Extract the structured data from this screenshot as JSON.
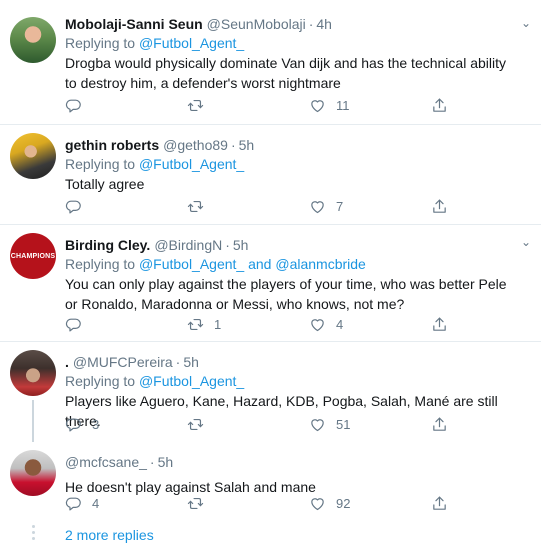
{
  "tweets": [
    {
      "name": "Mobolaji-Sanni Seun",
      "handle": "@SeunMobolaji",
      "time": "4h",
      "replying_prefix": "Replying to",
      "replying_to": "@Futbol_Agent_",
      "replying_and": "",
      "replying_to_2": "",
      "text": "Drogba would physically dominate Van dijk and has the technical ability to destroy him, a defender's worst nightmare",
      "replies": "",
      "retweets": "",
      "likes": "11"
    },
    {
      "name": "gethin roberts",
      "handle": "@getho89",
      "time": "5h",
      "replying_prefix": "Replying to",
      "replying_to": "@Futbol_Agent_",
      "replying_and": "",
      "replying_to_2": "",
      "text": "Totally agree",
      "replies": "",
      "retweets": "",
      "likes": "7"
    },
    {
      "name": "Birding Cley.",
      "handle": "@BirdingN",
      "time": "5h",
      "replying_prefix": "Replying to",
      "replying_to": "@Futbol_Agent_",
      "replying_and": "and",
      "replying_to_2": "@alanmcbride",
      "text": "You can only play against the players of your time, who was better Pele or Ronaldo, Maradonna or Messi, who knows, not me?",
      "replies": "",
      "retweets": "1",
      "likes": "4"
    },
    {
      "name": ".",
      "handle": "@MUFCPereira",
      "time": "5h",
      "replying_prefix": "Replying to",
      "replying_to": "@Futbol_Agent_",
      "replying_and": "",
      "replying_to_2": "",
      "text": "Players like Aguero, Kane, Hazard, KDB, Pogba, Salah, Mané are still there.",
      "replies": "3",
      "retweets": "",
      "likes": "51"
    },
    {
      "name": "",
      "handle": "@mcfcsane_",
      "time": "5h",
      "replying_prefix": "",
      "replying_to": "",
      "replying_and": "",
      "replying_to_2": "",
      "text": "He doesn't play against Salah and mane",
      "replies": "4",
      "retweets": "",
      "likes": "92"
    }
  ],
  "separator": "·",
  "more_replies": "2 more replies",
  "avatar_badge": "CHAMPIONS",
  "icons": {
    "reply": "reply-icon",
    "retweet": "retweet-icon",
    "like": "heart-icon",
    "share": "share-icon",
    "caret": "chevron-down-icon"
  },
  "colors": {
    "link": "#1b95e0",
    "muted": "#657786",
    "text": "#14171a",
    "divider": "#e6ecf0"
  }
}
